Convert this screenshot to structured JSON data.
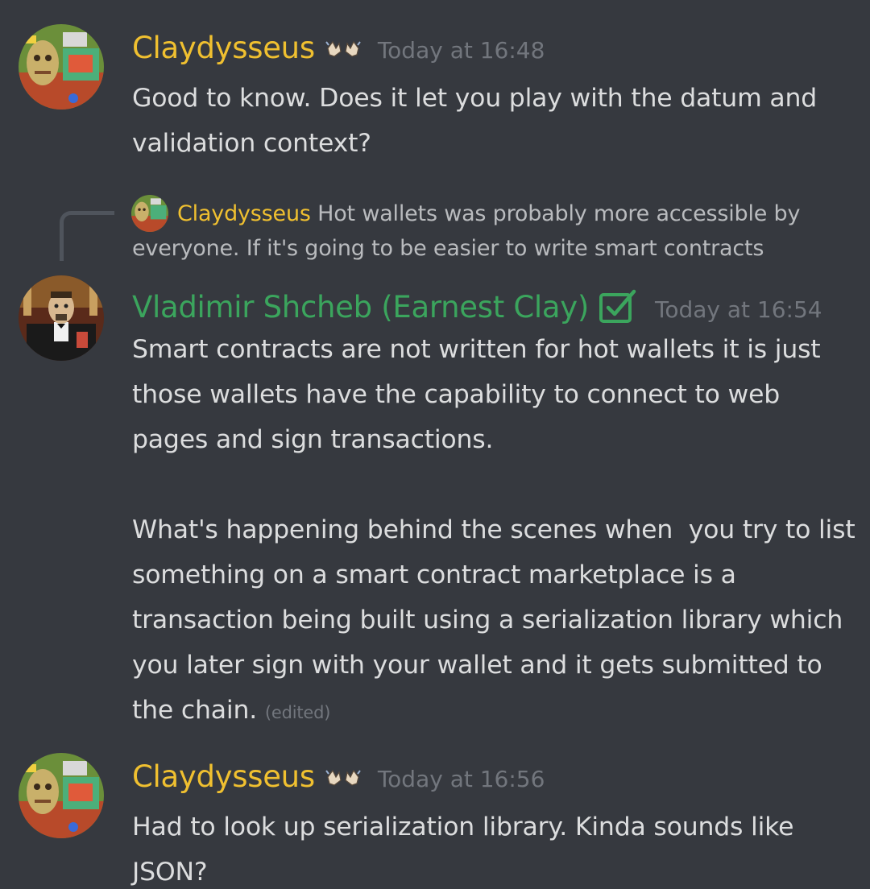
{
  "messages": [
    {
      "author": "Claydysseus",
      "author_color": "#f0c030",
      "badge": "hands-emoji-icon",
      "timestamp": "Today at 16:48",
      "text": "Good to know. Does it let you play with the datum and validation context?"
    },
    {
      "reply": {
        "author": "Claydysseus",
        "text": "Hot wallets was probably more accessible by everyone. If it's going to be easier to write smart contracts"
      },
      "author": "Vladimir Shcheb (Earnest Clay)",
      "author_color": "#3ba55d",
      "badge": "checkbox-check-icon",
      "timestamp": "Today at 16:54",
      "text": "Smart contracts are not written for hot wallets it is just those wallets have the capability to connect to web pages and sign transactions.\n\nWhat's happening behind the scenes when  you try to list something on a smart contract marketplace is a transaction being built using a serialization library which you later sign with your wallet and it gets submitted to the chain.",
      "edited_label": "(edited)"
    },
    {
      "author": "Claydysseus",
      "author_color": "#f0c030",
      "badge": "hands-emoji-icon",
      "timestamp": "Today at 16:56",
      "text": "Had to look up serialization library. Kinda sounds like JSON?"
    }
  ]
}
